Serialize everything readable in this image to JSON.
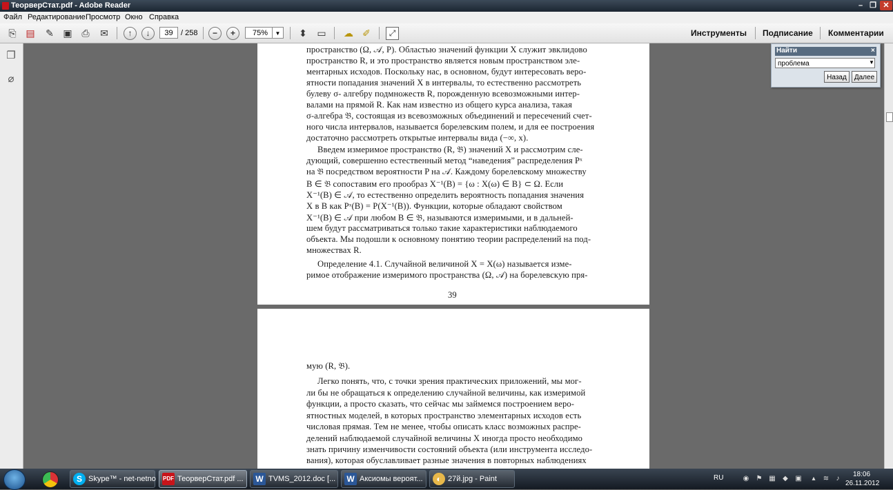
{
  "window": {
    "title": "ТеорверСтат.pdf - Adobe Reader"
  },
  "menu": [
    "Файл",
    "Редактирование",
    "Просмотр",
    "Окно",
    "Справка"
  ],
  "toolbar": {
    "page_current": "39",
    "page_total": "/ 258",
    "zoom": "75%",
    "tabs": [
      "Инструменты",
      "Подписание",
      "Комментарии"
    ]
  },
  "find": {
    "title": "Найти",
    "query": "проблема",
    "back_label": "Назад",
    "next_label": "Далее"
  },
  "page1": {
    "lines": [
      "пространство (Ω, 𝒜, P). Областью значений функции X служит эвклидово",
      "пространство R, и это пространство является новым пространством эле-",
      "ментарных исходов. Поскольку нас, в основном, будут интересовать веро-",
      "ятности попадания значений X в интервалы, то естественно рассмотреть",
      "булеву σ- алгебру подмножеств R, порожденную всевозможными интер-",
      "валами на прямой R. Как нам известно из общего курса анализа, такая",
      "σ-алгебра 𝔅, состоящая из всевозможных объединений и пересечений счет-",
      "ного числа интервалов, называется борелевским полем, и для ее построения",
      "достаточно рассмотреть открытые интервалы вида (−∞, x).",
      "Введем измеримое пространство (R, 𝔅) значений X и рассмотрим сле-",
      "дующий, совершенно естественный метод “наведения” распределения Pˣ",
      "на 𝔅 посредством вероятности P на 𝒜. Каждому борелевскому множеству",
      "B ∈ 𝔅 сопоставим его прообраз X⁻¹(B) = {ω : X(ω) ∈ B} ⊂ Ω. Если",
      "X⁻¹(B) ∈ 𝒜, то естественно определить вероятность попадания значения",
      "X в B как Pˣ(B) = P(X⁻¹(B)). Функции, которые обладают свойством",
      "X⁻¹(B) ∈ 𝒜 при любом B ∈ 𝔅, называются измеримыми, и в дальней-",
      "шем будут рассматриваться только такие характеристики наблюдаемого",
      "объекта. Мы подошли к основному понятию теории распределений на под-",
      "множествах R.",
      "Определение 4.1. Случайной величиной X = X(ω) называется изме-",
      "римое отображение измеримого пространства (Ω, 𝒜) на борелевскую пря-"
    ],
    "page_number": "39"
  },
  "page2": {
    "lines": [
      "мую (R, 𝔅).",
      "Легко понять, что, с точки зрения практических приложений, мы мог-",
      "ли бы не обращаться к определению случайной величины, как измеримой",
      "функции, а просто сказать, что сейчас мы займемся построением веро-",
      "ятностных моделей, в которых пространство элементарных исходов есть",
      "числовая прямая. Тем не менее, чтобы описать класс возможных распре-",
      "делений наблюдаемой случайной величины X иногда просто необходимо",
      "знать причину изменчивости состояний объекта (или инструмента исследо-",
      "вания), которая обуславливает разные значения в повторных наблюдениях"
    ]
  },
  "taskbar": {
    "tasks": [
      "Skype™ - net-netno",
      "ТеорверСтат.pdf ...",
      "TVMS_2012.doc [...",
      "Аксиомы вероят...",
      "27й.jpg - Paint"
    ],
    "lang": "RU",
    "time": "18:06",
    "date": "26.11.2012"
  }
}
